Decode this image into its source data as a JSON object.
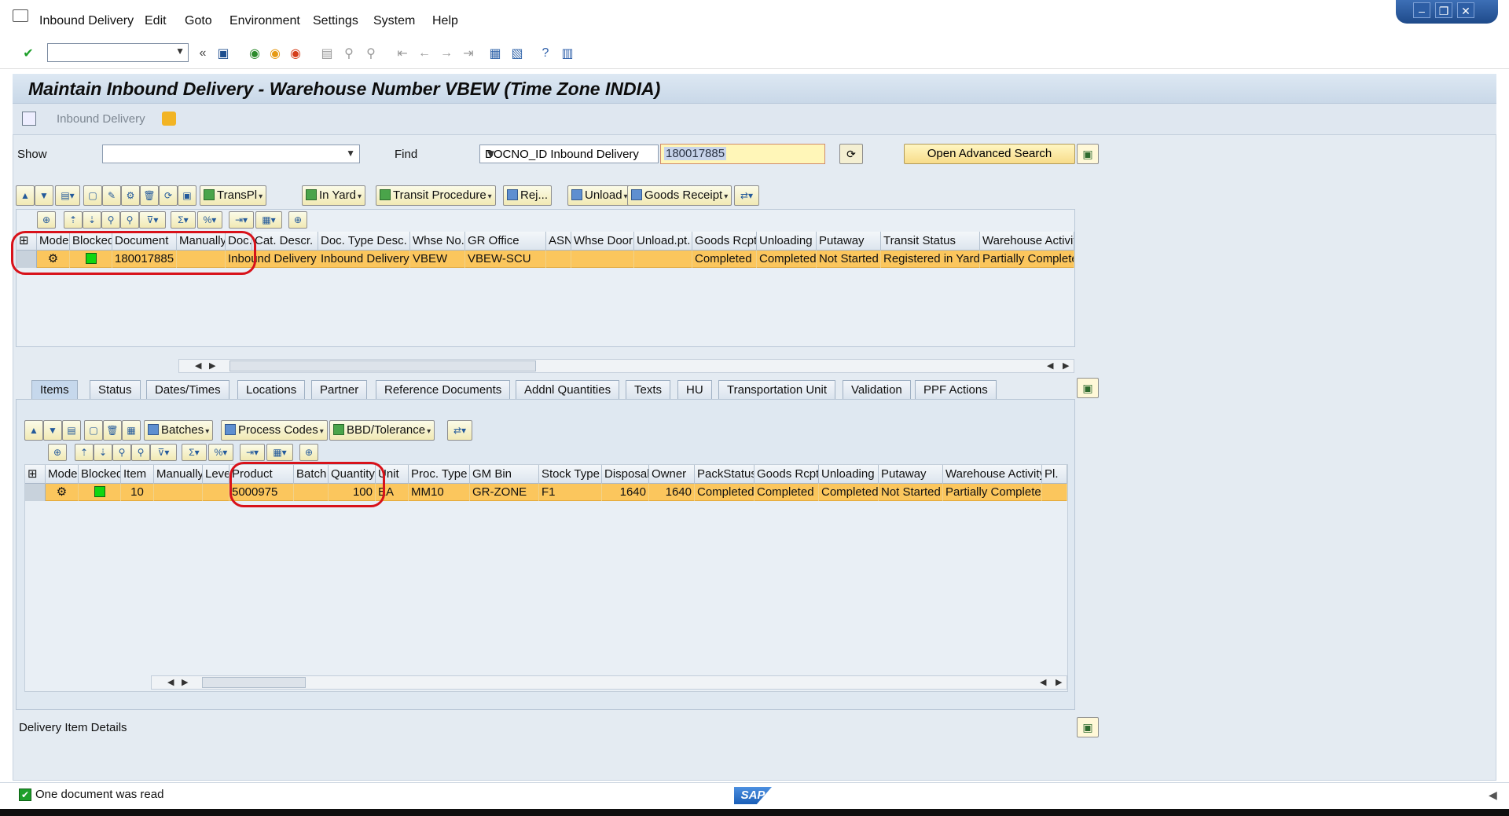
{
  "menu": [
    "Inbound Delivery",
    "Edit",
    "Goto",
    "Environment",
    "Settings",
    "System",
    "Help"
  ],
  "title": "Maintain Inbound Delivery - Warehouse Number VBEW (Time Zone INDIA)",
  "app_toolbar": {
    "label": "Inbound Delivery"
  },
  "search": {
    "show_label": "Show",
    "show_value": "",
    "find_label": "Find",
    "find_option": "DOCNO_ID Inbound Delivery",
    "value": "180017885",
    "adv_button": "Open Advanced Search"
  },
  "header_toolbar": {
    "transpl": "TransPl",
    "in_yard": "In Yard",
    "transit": "Transit Procedure",
    "rej": "Rej...",
    "unload": "Unload",
    "goods_receipt": "Goods Receipt"
  },
  "header_grid": {
    "columns": [
      "Mode",
      "Blocked",
      "Document",
      "Manually",
      "Doc.",
      "Cat. Descr.",
      "Doc. Type Desc.",
      "Whse No.",
      "GR Office",
      "ASN",
      "Whse Door",
      "Unload.pt.",
      "Goods Rcpt",
      "Unloading",
      "Putaway",
      "Transit Status",
      "Warehouse Activity"
    ],
    "row": {
      "document": "180017885",
      "cat_descr": "Inbound Delivery",
      "doc_type_desc": "Inbound Delivery",
      "whse_no": "VBEW",
      "gr_office": "VBEW-SCU",
      "goods_rcpt": "Completed",
      "unloading": "Completed",
      "putaway": "Not Started",
      "transit_status": "Registered in Yard",
      "warehouse_activity": "Partially Completed"
    }
  },
  "tabs": [
    "Items",
    "Status",
    "Dates/Times",
    "Locations",
    "Partner",
    "Reference Documents",
    "Addnl Quantities",
    "Texts",
    "HU",
    "Transportation Unit",
    "Validation",
    "PPF Actions"
  ],
  "items_toolbar": {
    "batches": "Batches",
    "process_codes": "Process Codes",
    "bbd": "BBD/Tolerance"
  },
  "items_grid": {
    "columns": [
      "Mode",
      "Blocked",
      "Item",
      "Manually",
      "Level",
      "Product",
      "Batch",
      "Quantity",
      "Unit",
      "Proc. Type",
      "GM Bin",
      "Stock Type",
      "Disposal",
      "Owner",
      "PackStatus",
      "Goods Rcpt",
      "Unloading",
      "Putaway",
      "Warehouse Activity",
      "Pl."
    ],
    "row": {
      "item": "10",
      "product": "5000975",
      "batch": "",
      "quantity": "100",
      "unit": "EA",
      "proc_type": "MM10",
      "gm_bin": "GR-ZONE",
      "stock_type": "F1",
      "disposal": "1640",
      "owner": "1640",
      "pack_status": "Completed",
      "goods_rcpt": "Completed",
      "unloading": "Completed",
      "putaway": "Not Started",
      "warehouse_activity": "Partially Completed"
    }
  },
  "details_label": "Delivery Item Details",
  "status_message": "One document was read",
  "sap_logo": "SAP",
  "colors": {
    "selected_row": "#fbc65d",
    "annotation": "#d8121a",
    "blocked_indicator": "#11d611"
  }
}
